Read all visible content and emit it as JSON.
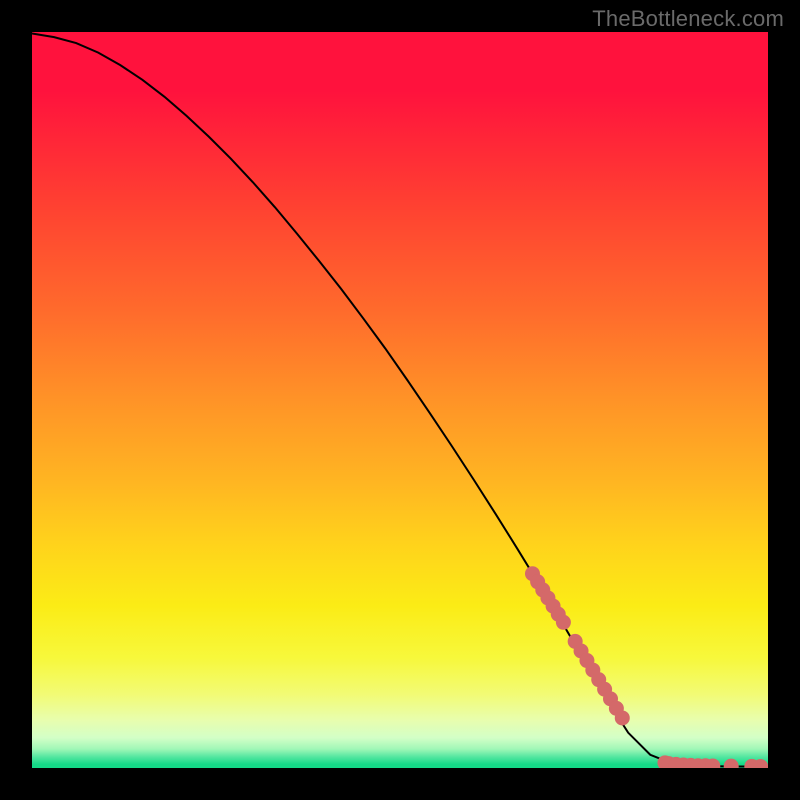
{
  "attribution": "TheBottleneck.com",
  "colors": {
    "curve": "#000000",
    "marker": "#d46969",
    "background_black": "#000000"
  },
  "chart_data": {
    "type": "line",
    "title": "",
    "xlabel": "",
    "ylabel": "",
    "xlim": [
      0,
      100
    ],
    "ylim": [
      0,
      100
    ],
    "curve": {
      "x": [
        0,
        3,
        6,
        9,
        12,
        15,
        18,
        21,
        24,
        27,
        30,
        33,
        36,
        39,
        42,
        45,
        48,
        51,
        54,
        57,
        60,
        63,
        66,
        69,
        72,
        75,
        78,
        81,
        84,
        87,
        88.5,
        90,
        92,
        94,
        96,
        98,
        100
      ],
      "y": [
        99.8,
        99.3,
        98.5,
        97.2,
        95.5,
        93.5,
        91.2,
        88.6,
        85.8,
        82.8,
        79.6,
        76.2,
        72.6,
        68.9,
        65.1,
        61.1,
        57.0,
        52.7,
        48.3,
        43.8,
        39.2,
        34.5,
        29.7,
        24.8,
        19.8,
        14.7,
        9.5,
        4.8,
        1.8,
        0.6,
        0.4,
        0.3,
        0.25,
        0.22,
        0.2,
        0.2,
        0.2
      ]
    },
    "markers": {
      "x": [
        68.0,
        68.7,
        69.4,
        70.1,
        70.8,
        71.5,
        72.2,
        73.8,
        74.6,
        75.4,
        76.2,
        77.0,
        77.8,
        78.6,
        79.4,
        80.2,
        86.0,
        86.5,
        87.5,
        88.5,
        89.5,
        90.5,
        91.5,
        92.5,
        95.0,
        97.8,
        99.0
      ],
      "y": [
        26.4,
        25.3,
        24.2,
        23.1,
        22.0,
        20.9,
        19.8,
        17.2,
        15.9,
        14.6,
        13.3,
        12.0,
        10.7,
        9.4,
        8.1,
        6.8,
        0.7,
        0.6,
        0.5,
        0.4,
        0.35,
        0.3,
        0.3,
        0.28,
        0.25,
        0.22,
        0.2
      ]
    },
    "gradient_bands": [
      {
        "band_y_top": 100,
        "band_y_bottom": 84,
        "css_color": "#ff123d"
      },
      {
        "band_y_top": 84,
        "band_y_bottom": 68,
        "css_color": "#ff4231"
      },
      {
        "band_y_top": 68,
        "band_y_bottom": 56,
        "css_color": "#ff6b2c"
      },
      {
        "band_y_top": 56,
        "band_y_bottom": 44,
        "css_color": "#ff9327"
      },
      {
        "band_y_top": 44,
        "band_y_bottom": 34,
        "css_color": "#ffb522"
      },
      {
        "band_y_top": 34,
        "band_y_bottom": 26,
        "css_color": "#ffd41b"
      },
      {
        "band_y_top": 26,
        "band_y_bottom": 18,
        "css_color": "#fbec16"
      },
      {
        "band_y_top": 18,
        "band_y_bottom": 12,
        "css_color": "#f7f83b"
      },
      {
        "band_y_top": 12,
        "band_y_bottom": 8,
        "css_color": "#f2fb75"
      },
      {
        "band_y_top": 8,
        "band_y_bottom": 5,
        "css_color": "#e8feae"
      },
      {
        "band_y_top": 5,
        "band_y_bottom": 3.2,
        "css_color": "#d3ffc7"
      },
      {
        "band_y_top": 3.2,
        "band_y_bottom": 2.0,
        "css_color": "#a1f7b7"
      },
      {
        "band_y_top": 2.0,
        "band_y_bottom": 1.0,
        "css_color": "#53e6a0"
      },
      {
        "band_y_top": 1.0,
        "band_y_bottom": 0.0,
        "css_color": "#15d987"
      }
    ]
  }
}
